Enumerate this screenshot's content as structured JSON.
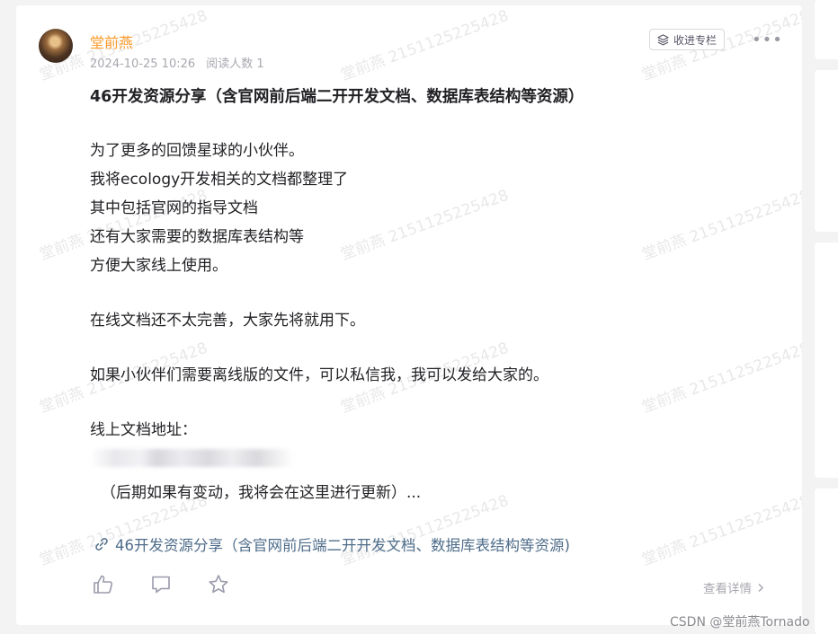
{
  "post": {
    "author": "堂前燕",
    "date": "2024-10-25 10:26",
    "read_count": "阅读人数 1",
    "collect_label": "收进专栏",
    "more_label": "•••",
    "title": "46开发资源分享（含官网前后端二开开发文档、数据库表结构等资源）",
    "paragraphs": [
      [
        "为了更多的回馈星球的小伙伴。",
        "我将ecology开发相关的文档都整理了",
        "其中包括官网的指导文档",
        "还有大家需要的数据库表结构等",
        "方便大家线上使用。"
      ],
      [
        "在线文档还不太完善，大家先将就用下。"
      ],
      [
        "如果小伙伴们需要离线版的文件，可以私信我，我可以发给大家的。"
      ],
      [
        "线上文档地址："
      ]
    ],
    "update_note": "（后期如果有变动，我将会在这里进行更新）...",
    "link_text": "46开发资源分享（含官网前后端二开开发文档、数据库表结构等资源)",
    "detail_label": "查看详情"
  },
  "icons": {
    "avatar": "avatar",
    "collect": "layers-icon",
    "link": "link-icon",
    "like": "thumbs-up-icon",
    "comment": "comment-icon",
    "favorite": "star-icon",
    "detail": "chevron-right-icon"
  },
  "watermark": "堂前燕 2151125225428",
  "credit": "CSDN @堂前燕Tornado",
  "colors": {
    "author": "#fc9b2a",
    "link": "#4f6d8a",
    "meta": "#a8a8b0"
  }
}
